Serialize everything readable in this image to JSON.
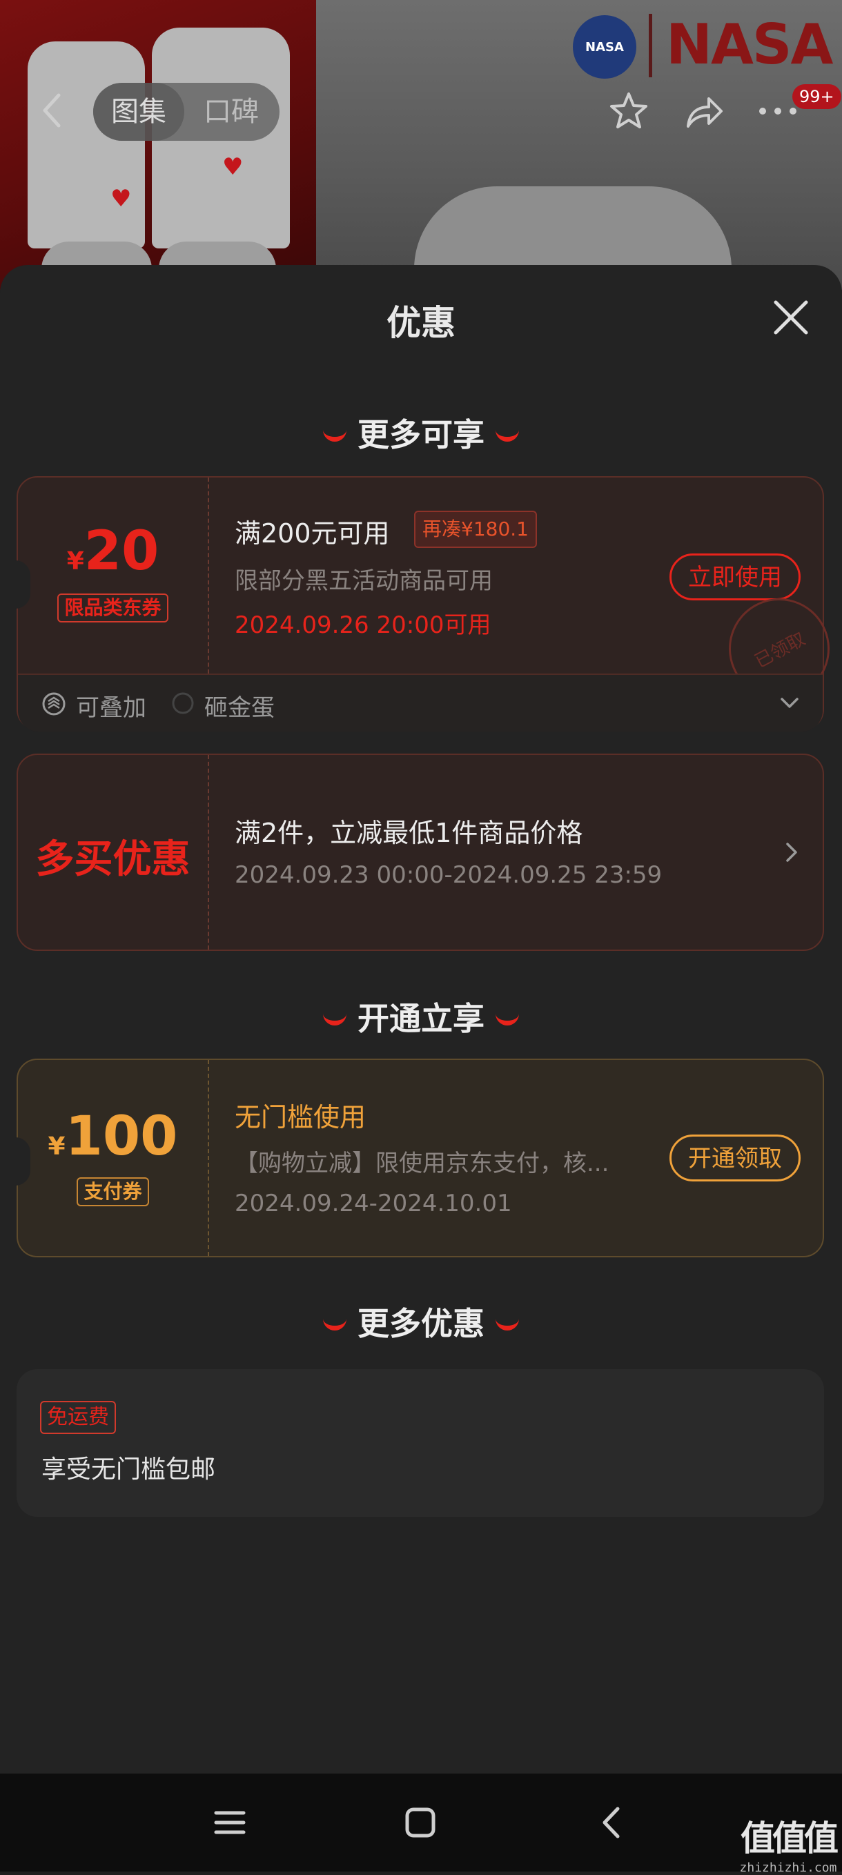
{
  "header": {
    "tabs": [
      {
        "label": "图集",
        "active": true
      },
      {
        "label": "口碑",
        "active": false
      }
    ],
    "brand_circle_text": "NASA",
    "brand_word": "NASA",
    "more_badge": "99+"
  },
  "sheet": {
    "title": "优惠"
  },
  "sections": {
    "more_available": "更多可享",
    "open_enjoy": "开通立享",
    "more_offers": "更多优惠"
  },
  "coupon1": {
    "currency": "¥",
    "amount": "20",
    "type_tag": "限品类东券",
    "title": "满200元可用",
    "extra_tag": "再凑¥180.1",
    "desc": "限部分黑五活动商品可用",
    "date": "2024.09.26 20:00可用",
    "button": "立即使用",
    "stamp": "已领取",
    "feature1": "可叠加",
    "feature2": "砸金蛋"
  },
  "multi_buy": {
    "label": "多买优惠",
    "title": "满2件，立减最低1件商品价格",
    "date": "2024.09.23 00:00-2024.09.25 23:59"
  },
  "coupon2": {
    "currency": "¥",
    "amount": "100",
    "type_tag": "支付券",
    "title": "无门槛使用",
    "desc": "【购物立减】限使用京东支付，核...",
    "date": "2024.09.24-2024.10.01",
    "button": "开通领取"
  },
  "shipping": {
    "tag": "免运费",
    "text": "享受无门槛包邮"
  },
  "watermark": {
    "logo": "值值值",
    "site": "zhizhizhi.com"
  },
  "colors": {
    "accent_red": "#e8231b",
    "gold": "#f0a23a",
    "sheet_bg": "#232323"
  }
}
